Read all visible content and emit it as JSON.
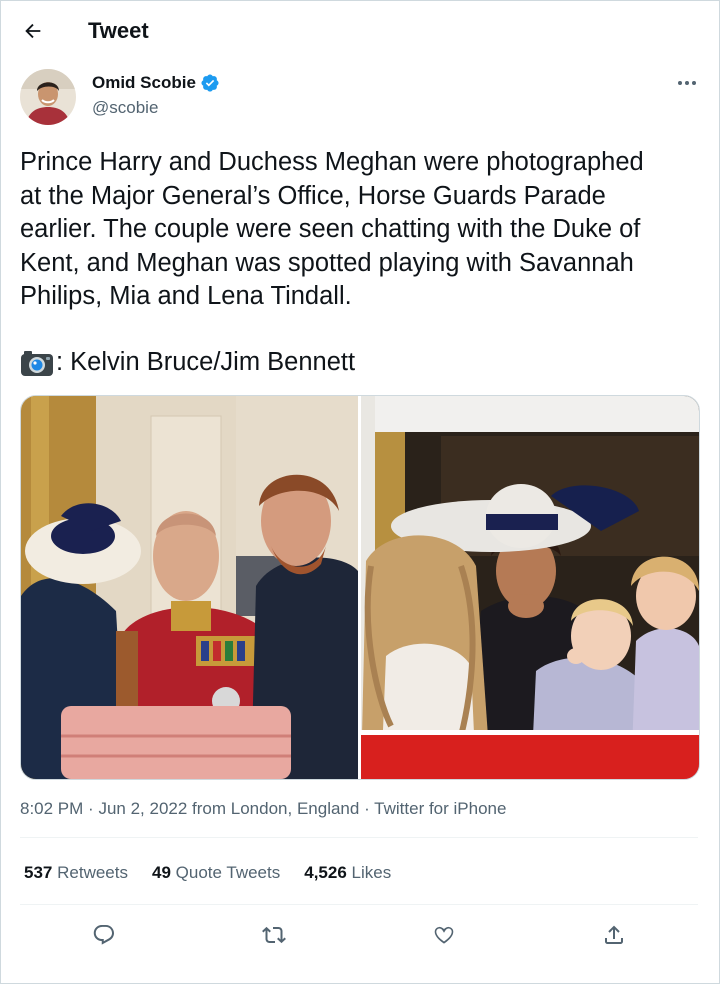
{
  "header": {
    "title": "Tweet",
    "back_icon": "arrow-left-icon"
  },
  "author": {
    "name": "Omid Scobie",
    "handle": "@scobie",
    "verified_icon": "verified-badge-icon",
    "more_icon": "more-horizontal-icon"
  },
  "tweet": {
    "text": "Prince Harry and Duchess Meghan were photographed\nat the Major General’s Office, Horse Guards Parade\nearlier. The couple were seen chatting with the Duke of\nKent, and Meghan was spotted playing with Savannah\nPhilips, Mia and Lena Tindall.",
    "credit_icon": "camera-emoji-icon",
    "credit_text": ": Kelvin Bruce/Jim Bennett"
  },
  "meta": {
    "time": "8:02 PM",
    "date": "Jun 2, 2022",
    "location": "from London, England",
    "source": "Twitter for iPhone",
    "sep": "·"
  },
  "stats": [
    {
      "count": "537",
      "label": "Retweets"
    },
    {
      "count": "49",
      "label": "Quote Tweets"
    },
    {
      "count": "4,526",
      "label": "Likes"
    }
  ],
  "actions": {
    "reply_icon": "reply-icon",
    "retweet_icon": "retweet-icon",
    "like_icon": "heart-icon",
    "share_icon": "share-icon"
  },
  "colors": {
    "accent": "#1d9bf0",
    "text": "#0f1419",
    "secondary": "#536471",
    "border": "#cfd9de"
  }
}
